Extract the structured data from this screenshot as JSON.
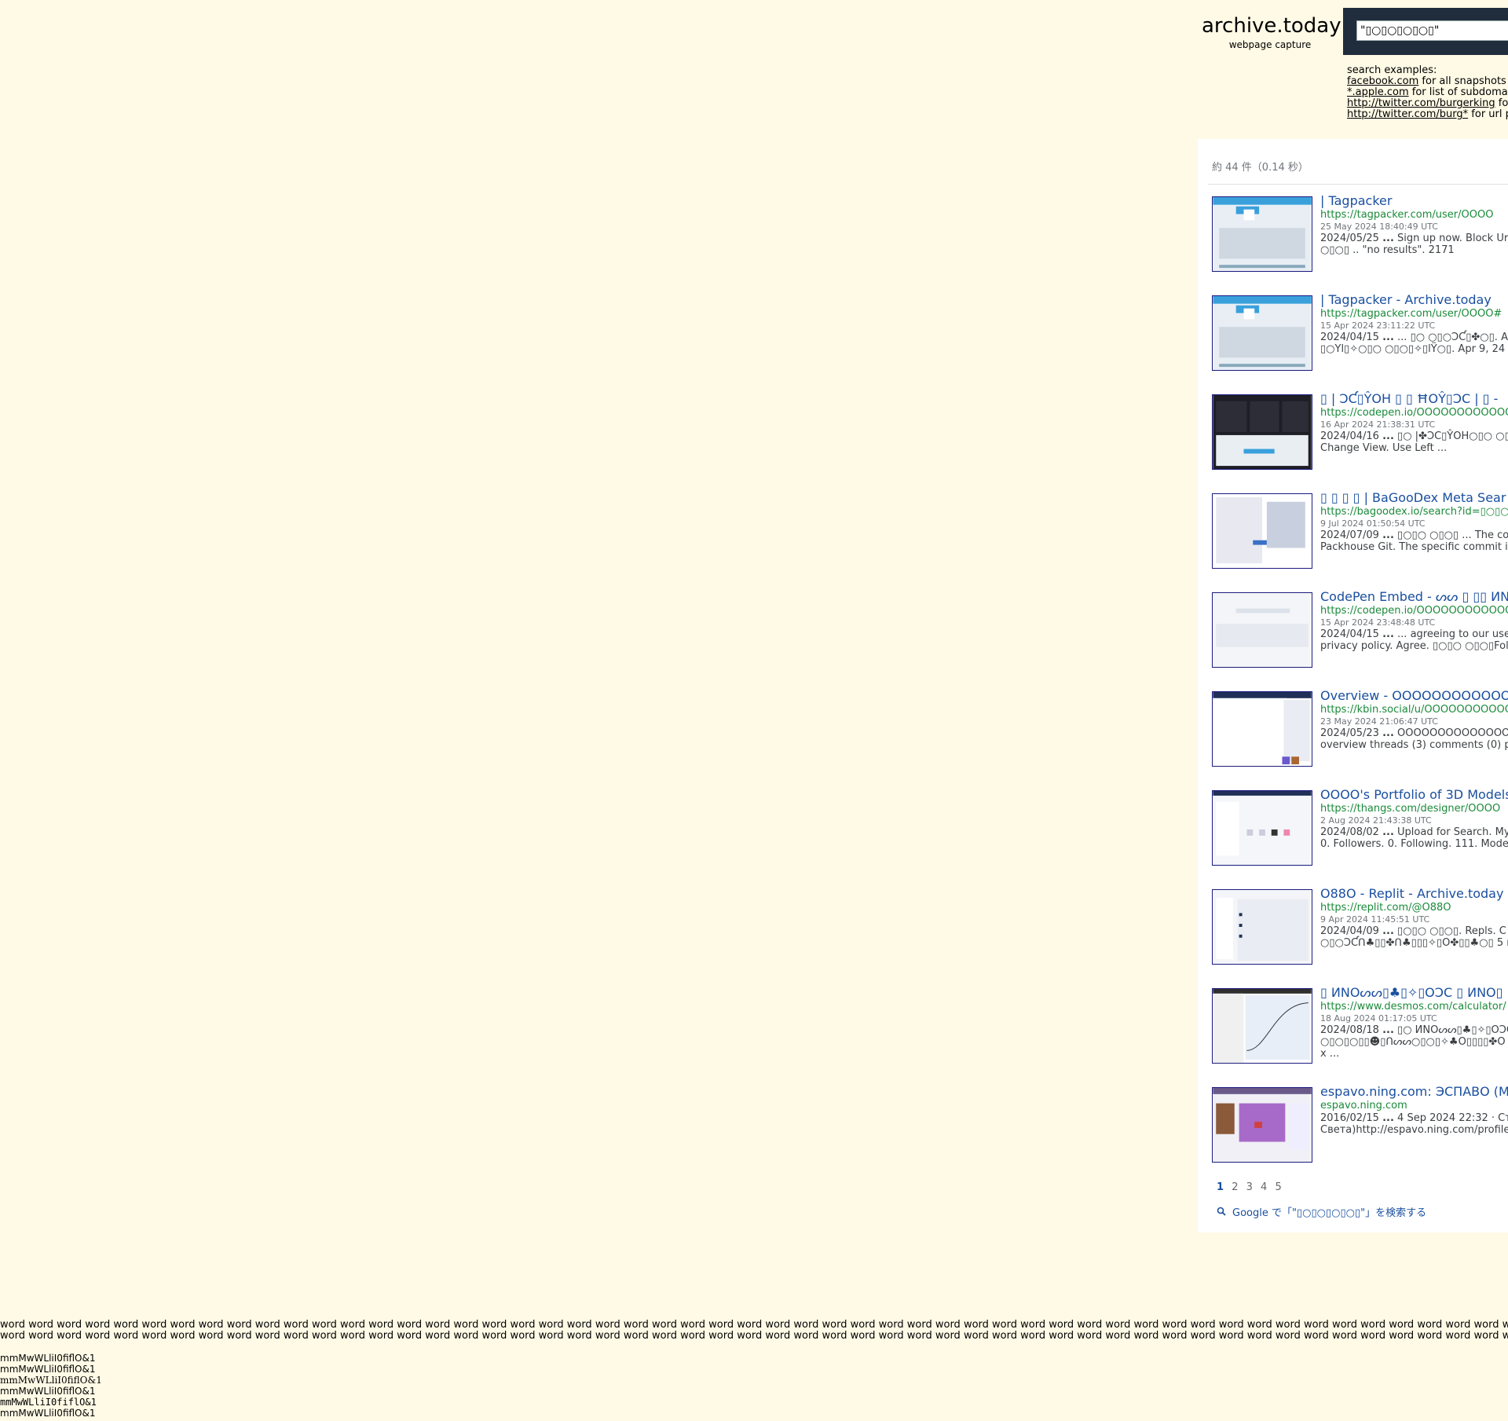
{
  "brand": {
    "title": "archive.today",
    "subtitle": "webpage capture"
  },
  "search": {
    "value": "\"▯○▯○▯○▯○▯\""
  },
  "examples": {
    "heading": "search examples:",
    "items": [
      {
        "link": "facebook.com",
        "text": " for all snapshots fro"
      },
      {
        "link": "*.apple.com",
        "text": " for list of subdomains"
      },
      {
        "link": "http://twitter.com/burgerking",
        "text": " for e"
      },
      {
        "link": "http://twitter.com/burg*",
        "text": " for url pre"
      }
    ]
  },
  "results_count": "約 44 件（0.14 秒）",
  "results": [
    {
      "title": "| Tagpacker",
      "url": "https://tagpacker.com/user/OOOO",
      "date": "25 May 2024 18:40:49 UTC",
      "snippet_line1_date": "2024/05/25",
      "snippet_line1": " Sign up now. Block Ur",
      "snippet_line2": "○▯○▯                .. \"no results\". 2171",
      "thumb_theme": "tagpacker"
    },
    {
      "title": "| Tagpacker - Archive.today",
      "url": "https://tagpacker.com/user/OOOO#",
      "date": "15 Apr 2024 23:11:22 UTC",
      "snippet_line1_date": "2024/04/15",
      "snippet_line1": " ... ▯○  ○▯○ƆƇ▯✤○▯. A",
      "snippet_line2": "▯○Yl▯✧○▯○  ○▯○▯✧▯lŸ○▯. Apr 9, 24",
      "thumb_theme": "tagpacker"
    },
    {
      "title": "▯ | ƆƇ▯ŶOH ▯ ▯ ĦOŶ▯ƆC | ▯ -",
      "url": "https://codepen.io/OOOOOOOOOOOO",
      "date": "16 Apr 2024 21:38:31 UTC",
      "snippet_line1_date": "2024/04/16",
      "snippet_line1": " ▯○ |✤ƆC▯ŶOH○▯○  ○▯",
      "snippet_line2": "Change View. Use Left ...",
      "thumb_theme": "codepen"
    },
    {
      "title": "▯ ▯ ▯ ▯ | BaGooDex Meta Sear",
      "url": "https://bagoodex.io/search?id=▯○▯○",
      "date": "9 Jul 2024 01:50:54 UTC",
      "snippet_line1_date": "2024/07/09",
      "snippet_line1": " ▯○▯○  ○▯○▯ ... The co",
      "snippet_line2": "Packhouse Git. The specific commit i",
      "thumb_theme": "bagoodex"
    },
    {
      "title": "CodePen Embed - ᔕᔕ ▯ ▯▯ ИN",
      "url": "https://codepen.io/OOOOOOOOOOOO",
      "date": "15 Apr 2024 23:48:48 UTC",
      "snippet_line1_date": "2024/04/15",
      "snippet_line1": " ... agreeing to our use",
      "snippet_line2": "privacy policy. Agree. ▯○▯○  ○▯○▯Fol",
      "thumb_theme": "blank"
    },
    {
      "title": "Overview - OOOOOOOOOOOO",
      "url": "https://kbin.social/u/OOOOOOOOOOOO",
      "date": "23 May 2024 21:06:47 UTC",
      "snippet_line1_date": "2024/05/23",
      "snippet_line1": " OOOOOOOOOOOOOO",
      "snippet_line2": "overview threads (3) comments (0) p",
      "thumb_theme": "kbin"
    },
    {
      "title": "OOOO's Portfolio of 3D Models",
      "url": "https://thangs.com/designer/OOOO",
      "date": "2 Aug 2024 21:43:38 UTC",
      "snippet_line1_date": "2024/08/02",
      "snippet_line1": " Upload for Search. My",
      "snippet_line2": "0. Followers. 0. Following. 111. Mode",
      "thumb_theme": "thangs"
    },
    {
      "title": "O88O - Replit - Archive.today",
      "url": "https://replit.com/@O88O",
      "date": "9 Apr 2024 11:45:51 UTC",
      "snippet_line1_date": "2024/04/09",
      "snippet_line1": " ▯○▯○  ○▯○▯. Repls. C",
      "snippet_line2": "○▯○ƆƇꓵ♣▯▯✤ꓵ♣▯▯▯✧▯O✤▯▯♣○▯ 5 r",
      "thumb_theme": "replit"
    },
    {
      "title": "▯ ИNOᔕᔕ▯♣▯✧▯OƆC ▯ ИNO▯ |",
      "url": "https://www.desmos.com/calculator/",
      "date": "18 Aug 2024 01:17:05 UTC",
      "snippet_line1_date": "2024/08/18",
      "snippet_line1": " ▯○ ИNOᔕᔕ▯♣▯✧▯OƆC",
      "snippet_line2": "○▯○▯○▯▯☻▯ꓵᔕᔕ○▯○▯✧♣O▯▯▯▯✤O",
      "snippet_line3": "x ...",
      "thumb_theme": "desmos"
    },
    {
      "title": "espavo.ning.com: ЭСПАВО (М",
      "url": "espavo.ning.com",
      "date": "",
      "snippet_line1_date": "2016/02/15",
      "snippet_line1": " 4 Sep 2024 22:32 · Ст",
      "snippet_line2": "Света)http://espavo.ning.com/profile",
      "thumb_theme": "espavo"
    }
  ],
  "pagination": {
    "pages": [
      "1",
      "2",
      "3",
      "4",
      "5"
    ],
    "current": "1"
  },
  "google_search": "Google で「\"▯○▯○▯○▯○▯\"」を検索する",
  "word_line": "word word word word word word word word word word word word word word word word word word word word word word word word word word word word word word word word word word word word word word word word word word word word word word word word word word word word word word word word word word word word word word word word word word word word word word word word word word wor",
  "test_lines": [
    "mmMwWLliI0fiflO&1",
    "mmMwWLliI0fiflO&1",
    "mmMwWLliI0fiflO&1",
    "mmMwWLliI0fiflO&1",
    "mmMwWLliI0fiflO&1",
    "mmMwWLliI0fiflO&1"
  ]
}
